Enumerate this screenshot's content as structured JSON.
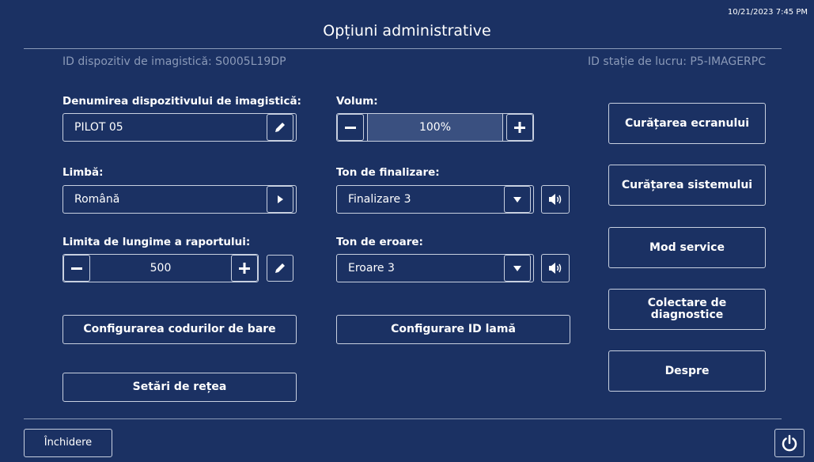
{
  "header": {
    "title": "Opțiuni administrative",
    "timestamp": "10/21/2023 7:45 PM",
    "device_id": "ID dispozitiv de imagistică: S0005L19DP",
    "workstation_id": "ID stație de lucru: P5-IMAGERPC"
  },
  "device_name": {
    "label": "Denumirea dispozitivului de imagistică:",
    "value": "PILOT 05"
  },
  "language": {
    "label": "Limbă:",
    "value": "Română"
  },
  "report_limit": {
    "label": "Limita de lungime a raportului:",
    "value": "500"
  },
  "volume": {
    "label": "Volum:",
    "value": "100%",
    "level_percent": 100
  },
  "finish_tone": {
    "label": "Ton de finalizare:",
    "value": "Finalizare 3"
  },
  "error_tone": {
    "label": "Ton de eroare:",
    "value": "Eroare 3"
  },
  "buttons": {
    "barcode_config": "Configurarea codurilor de bare",
    "network_settings": "Setări de rețea",
    "slide_id_config": "Configurare ID lamă",
    "clean_screen": "Curățarea ecranului",
    "clean_system": "Curățarea sistemului",
    "service_mode": "Mod service",
    "collect_diagnostics": "Colectare de diagnostice",
    "about": "Despre",
    "close": "Închidere"
  },
  "icons": {
    "edit": "pencil-icon",
    "arrow_right": "play-arrow-icon",
    "minus": "minus-icon",
    "plus": "plus-icon",
    "dropdown": "caret-down-icon",
    "speaker": "speaker-icon",
    "power": "power-icon"
  },
  "colors": {
    "background": "#1b3163",
    "border": "#c8d0e0",
    "muted_text": "#8b9ab8",
    "volume_fill": "#3a5080"
  }
}
